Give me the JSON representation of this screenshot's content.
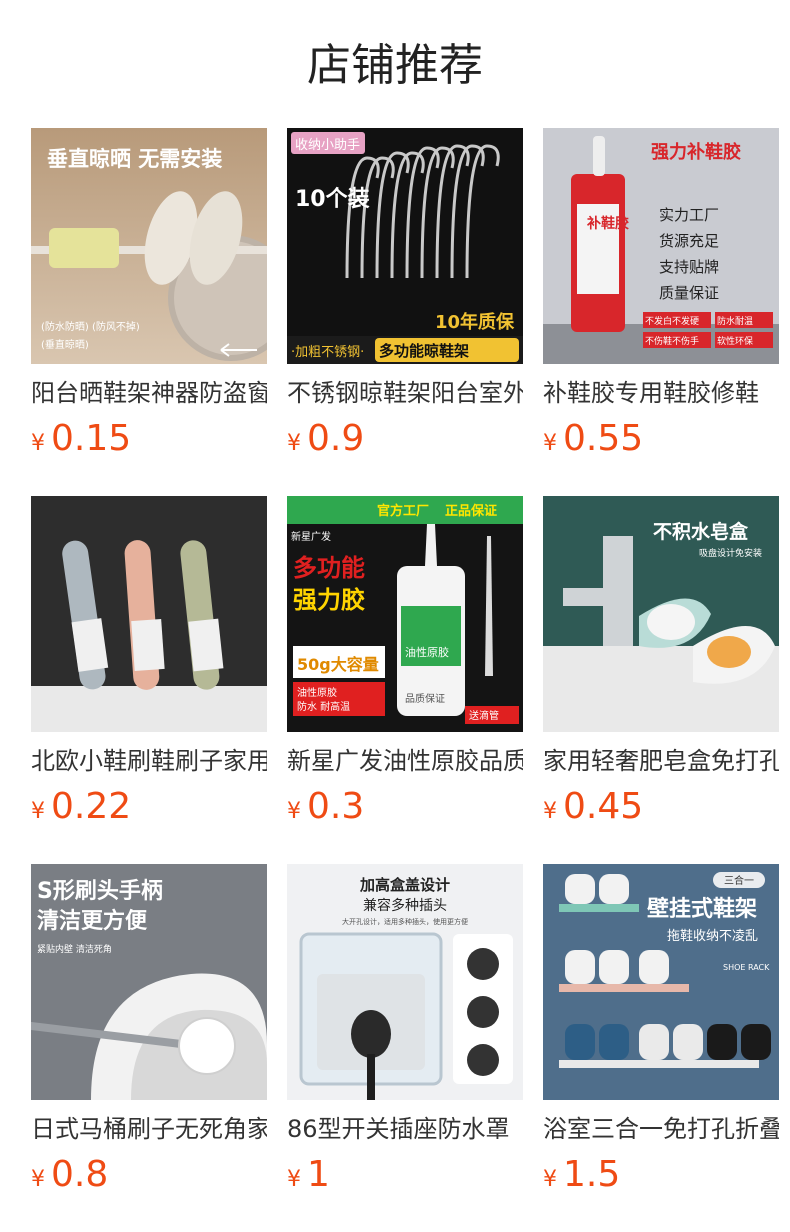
{
  "header": {
    "title": "店铺推荐"
  },
  "currency": "¥",
  "products": [
    {
      "name": "阳台晒鞋架神器防盗窗",
      "price": "0.15",
      "art": [
        "垂直晾晒 无需安装",
        "(防水防晒) (防风不掉)",
        "(垂直晾晒)"
      ]
    },
    {
      "name": "不锈钢晾鞋架阳台室外",
      "price": "0.9",
      "art": [
        "收纳小助手",
        "10个装",
        "10年质保",
        "·加粗不锈钢·",
        "多功能晾鞋架"
      ]
    },
    {
      "name": "补鞋胶专用鞋胶修鞋",
      "price": "0.55",
      "art": [
        "强力补鞋胶",
        "补鞋胶",
        "实力工厂",
        "货源充足",
        "支持贴牌",
        "质量保证",
        "不发白不发硬",
        "防水耐温",
        "不伤鞋不伤手",
        "软性环保"
      ]
    },
    {
      "name": "北欧小鞋刷鞋刷子家用",
      "price": "0.22",
      "art": []
    },
    {
      "name": "新星广发油性原胶品质",
      "price": "0.3",
      "art": [
        "官方工厂",
        "正品保证",
        "新星广发",
        "多功能",
        "强力胶",
        "50g大容量",
        "油性原胶",
        "防水 耐高温",
        "油性原胶",
        "品质保证",
        "送滴管"
      ]
    },
    {
      "name": "家用轻奢肥皂盒免打孔",
      "price": "0.45",
      "art": [
        "不积水皂盒",
        "吸盘设计免安装"
      ]
    },
    {
      "name": "日式马桶刷子无死角家用",
      "price": "0.8",
      "art": [
        "S形刷头手柄",
        "清洁更方便",
        "紧贴内壁 清洁死角"
      ]
    },
    {
      "name": "86型开关插座防水罩",
      "price": "1",
      "art": [
        "加高盒盖设计",
        "兼容多种插头",
        "大开孔设计，适用多种插头，使用更方便"
      ]
    },
    {
      "name": "浴室三合一免打孔折叠",
      "price": "1.5",
      "art": [
        "三合一",
        "壁挂式鞋架",
        "拖鞋收纳不凌乱",
        "SHOE RACK"
      ]
    }
  ],
  "colors": {
    "price": "#ef4b14",
    "title": "#222222"
  }
}
